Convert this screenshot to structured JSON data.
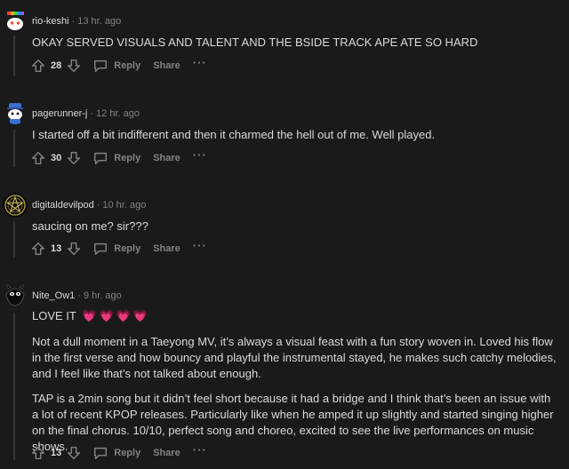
{
  "comments": [
    {
      "username": "rio-keshi",
      "time": "13 hr. ago",
      "paragraphs": [
        "OKAY SERVED VISUALS AND TALENT AND THE BSIDE TRACK APE ATE SO HARD"
      ],
      "votes": "28",
      "avatar_icon": "snoo-avatar-icon"
    },
    {
      "username": "pagerunner-j",
      "time": "12 hr. ago",
      "paragraphs": [
        "I started off a bit indifferent and then it charmed the hell out of me. Well played."
      ],
      "votes": "30",
      "avatar_icon": "snoo-avatar-icon"
    },
    {
      "username": "digitaldevilpod",
      "time": "10 hr. ago",
      "paragraphs": [
        "saucing on me? sir???"
      ],
      "votes": "13",
      "avatar_icon": "pentagram-avatar-icon"
    },
    {
      "username": "Nite_Ow1",
      "time": "9 hr. ago",
      "paragraphs": [
        "LOVE IT",
        "Not a dull moment in a Taeyong MV, it’s always a visual feast with a fun story woven in. Loved his flow in the first verse and how bouncy and playful the instrumental stayed, he makes such catchy melodies, and I feel like that’s not talked about enough.",
        "TAP is a 2min song but it didn’t feel short because it had a bridge and I think that’s been an issue with a lot of recent KPOP releases. Particularly like when he amped it up slightly and started singing higher on the final chorus. 10/10, perfect song and choreo, excited to see the live performances on music shows."
      ],
      "emoji": [
        "💗",
        "💗",
        "💗",
        "💗"
      ],
      "votes": "13",
      "avatar_icon": "snoo-avatar-icon"
    }
  ],
  "labels": {
    "separator": "·",
    "reply": "Reply",
    "share": "Share",
    "more": "···"
  },
  "colors": {
    "background": "#1a1a1b",
    "text": "#d7dadc",
    "meta": "#818384",
    "thread_line": "#343536",
    "heart": "#ff5fa8"
  }
}
